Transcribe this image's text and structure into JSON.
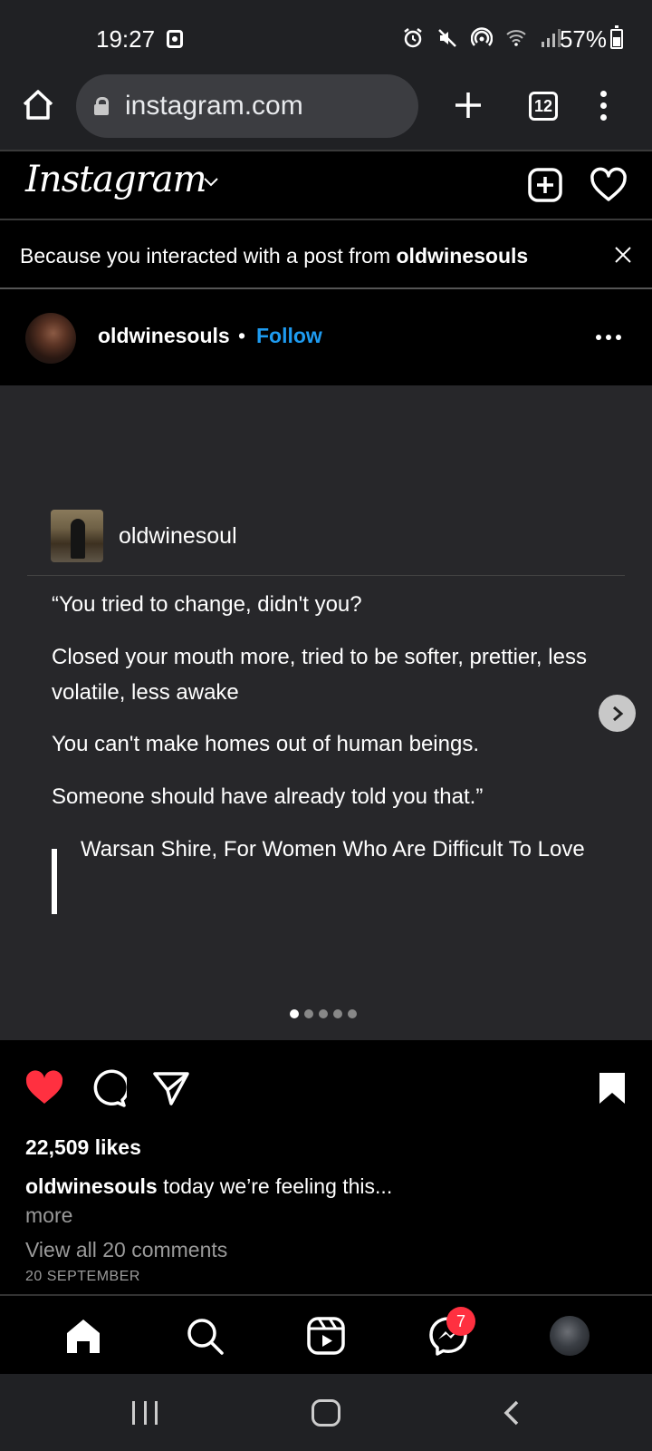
{
  "status_bar": {
    "time": "19:27",
    "battery": "57%"
  },
  "browser": {
    "url": "instagram.com",
    "tab_count": "12"
  },
  "instagram": {
    "logo": "Instagram"
  },
  "suggestion": {
    "prefix": "Because you interacted with a post from ",
    "account": "oldwinesouls"
  },
  "post": {
    "username": "oldwinesouls",
    "separator": "•",
    "follow_label": "Follow",
    "image": {
      "inner_username": "oldwinesoul",
      "quote_lines": [
        "“You tried to change, didn't you?",
        "Closed your mouth more, tried to be softer, prettier, less volatile, less awake",
        "You can't make homes out of human beings.",
        "Someone should have already told you that.”"
      ],
      "attribution": "Warsan Shire, For Women Who Are Difficult To Love",
      "carousel_count": 5,
      "carousel_active_index": 0
    },
    "liked": true,
    "saved": true,
    "likes": "22,509 likes",
    "caption_user": "oldwinesouls",
    "caption_text": " today we’re feeling this...",
    "more_label": "more",
    "view_comments": "View all 20 comments",
    "date": "20 SEPTEMBER"
  },
  "bottom_nav": {
    "messenger_badge": "7",
    "items": [
      "home-icon",
      "search-icon",
      "reels-icon",
      "messenger-icon",
      "profile-avatar"
    ]
  },
  "colors": {
    "follow_blue": "#1e9bf0",
    "like_red": "#ff3040",
    "chrome_bg": "#202124",
    "post_bg": "#27272a"
  }
}
